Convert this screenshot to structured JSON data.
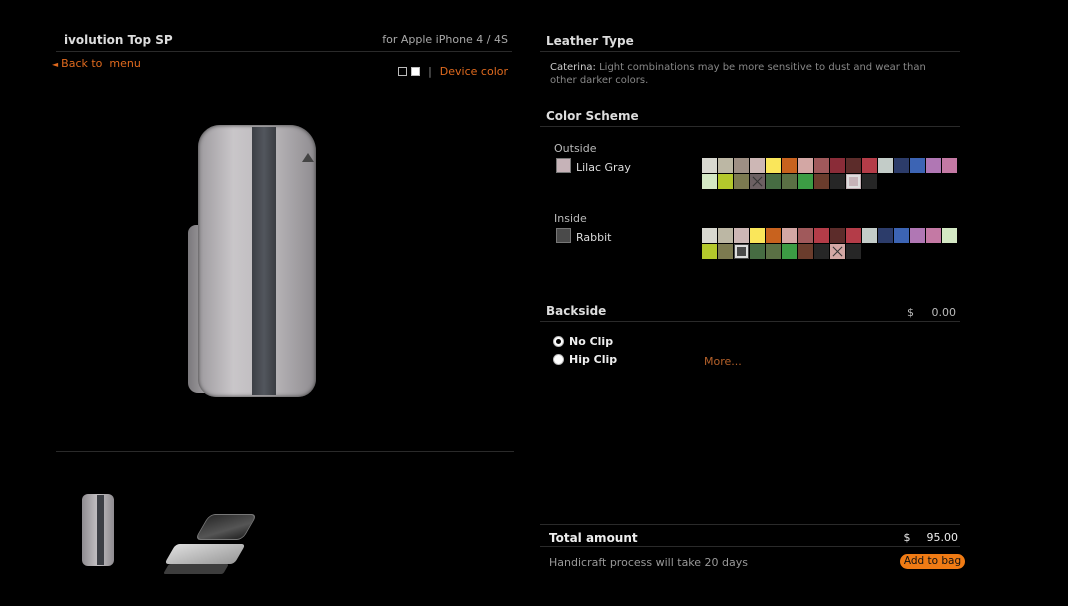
{
  "product": {
    "title": "ivolution Top SP",
    "device": "for Apple iPhone 4 / 4S",
    "back_link": "Back to  menu",
    "device_color_label": "Device color"
  },
  "leather": {
    "heading": "Leather Type",
    "name": "Caterina:",
    "description": "Light combinations may be more sensitive to dust and wear than other darker colors."
  },
  "color_scheme": {
    "heading": "Color Scheme",
    "outside": {
      "label": "Outside",
      "selected_name": "Lilac Gray",
      "selected_color": "#c6b3b8",
      "swatches": [
        "#d8d8d0",
        "#bcb7a4",
        "#9e8f84",
        "#cdb7b5",
        "#fae65a",
        "#c8621e",
        "#d3a7a4",
        "#a0595b",
        "#8a2c38",
        "#5c2c2a",
        "#b43c48",
        "#c3ccc8",
        "#2c3c6a",
        "#3c64b4",
        "#b077b4",
        "#c479a4",
        "#d4e8c4",
        "#b4c82c",
        "#7c7a50",
        "#6c6062",
        "#466c42",
        "#5a7044",
        "#3c9c44",
        "#6a3c2c",
        "#262626",
        "#c6b3b8",
        "#262626"
      ],
      "crossed": [
        19
      ],
      "selected": [
        25
      ]
    },
    "inside": {
      "label": "Inside",
      "selected_name": "Rabbit",
      "selected_color": "#4a4a4a",
      "swatches": [
        "#d8d8d0",
        "#bcb7a4",
        "#cdb7b5",
        "#fae65a",
        "#c8621e",
        "#d3a7a4",
        "#a0595b",
        "#b43c48",
        "#5c2c2a",
        "#b43c48",
        "#c3ccc8",
        "#2c3c6a",
        "#3c64b4",
        "#b077b4",
        "#c479a4",
        "#d4e8c4",
        "#b4c82c",
        "#7c7a50",
        "#4a4a4a",
        "#466c42",
        "#5a7044",
        "#3c9c44",
        "#6a3c2c",
        "#262626",
        "#d3a7a4",
        "#262626"
      ],
      "crossed": [
        24
      ],
      "selected": [
        18
      ]
    }
  },
  "backside": {
    "heading": "Backside",
    "currency": "$",
    "price": "0.00",
    "options": [
      {
        "label": "No Clip",
        "checked": true
      },
      {
        "label": "Hip Clip",
        "checked": false
      }
    ],
    "more_link": "More..."
  },
  "total": {
    "label": "Total amount",
    "currency": "$",
    "value": "95.00",
    "handicraft_note": "Handicraft process will take 20 days",
    "add_to_bag": "Add to bag"
  }
}
